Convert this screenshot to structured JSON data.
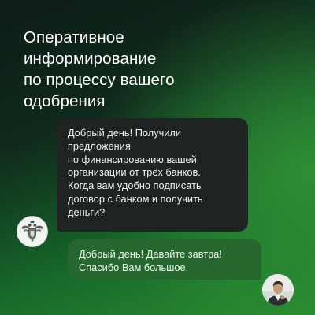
{
  "headline": {
    "lines": [
      "Оперативное",
      "информирование",
      "по процессу вашего",
      "одобрения"
    ]
  },
  "messages": {
    "incoming": {
      "lines": [
        "Добрый день! Получили",
        "предложения",
        "по финансированию вашей",
        "организации от трёх банков.",
        "Когда вам удобно подписать",
        "договор с банком и получить",
        "деньги?"
      ],
      "avatar_icon": "bank-emblem-icon"
    },
    "outgoing": {
      "lines": [
        "Добрый день! Давайте завтра!",
        "Спасибо Вам большое."
      ],
      "avatar_icon": "user-photo-icon"
    }
  },
  "colors": {
    "background_dark": "#0e1c16",
    "background_accent": "#2a8d31",
    "incoming_bubble": "#1f2321",
    "outgoing_bubble": "#25672f",
    "text": "#ffffff"
  }
}
